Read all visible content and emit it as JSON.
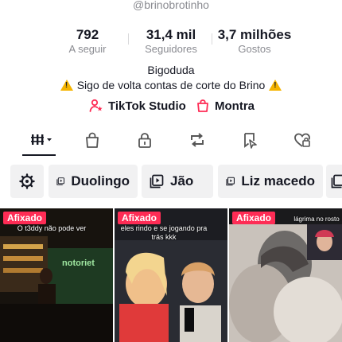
{
  "profile": {
    "username": "@brinobrotinho",
    "nickname": "Bigoduda",
    "bio_text": "Sigo de volta contas de corte do Brino"
  },
  "stats": [
    {
      "value": "792",
      "label": "A seguir"
    },
    {
      "value": "31,4 mil",
      "label": "Seguidores"
    },
    {
      "value": "3,7 milhões",
      "label": "Gostos"
    }
  ],
  "links": {
    "studio": "TikTok Studio",
    "shop": "Montra"
  },
  "tabs": [
    {
      "icon": "grid-icon"
    },
    {
      "icon": "shopping-bag-icon"
    },
    {
      "icon": "lock-icon"
    },
    {
      "icon": "repost-icon"
    },
    {
      "icon": "bookmark-icon"
    },
    {
      "icon": "liked-heart-icon"
    }
  ],
  "playlists": [
    {
      "icon": "gear-icon"
    },
    {
      "label": "Duolingo"
    },
    {
      "label": "Jão"
    },
    {
      "label": "Liz macedo"
    }
  ],
  "videos": [
    {
      "pinned_label": "Afixado",
      "caption": "O t3ddy não pode ver"
    },
    {
      "pinned_label": "Afixado",
      "caption": "eles rindo e se jogando pra trás kkk"
    },
    {
      "pinned_label": "Afixado",
      "caption": "lágrima no rosto"
    }
  ],
  "colors": {
    "accent": "#fe2c55",
    "text": "#161823",
    "muted": "#8a8b91",
    "chip_bg": "#f1f1f2",
    "warning": "#f5b400"
  }
}
